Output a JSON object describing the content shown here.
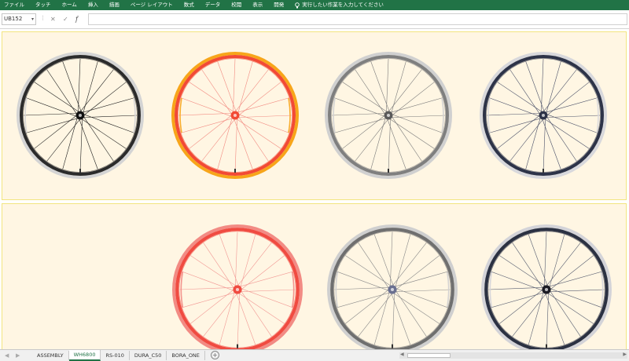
{
  "ribbon": {
    "menu": [
      "ファイル",
      "タッチ",
      "ホーム",
      "挿入",
      "描画",
      "ページ レイアウト",
      "数式",
      "データ",
      "校閲",
      "表示",
      "開発"
    ],
    "tell_me": "実行したい作業を入力してください"
  },
  "formula_bar": {
    "name_box": "UB152",
    "formula": ""
  },
  "sheet": {
    "wheels_row1": [
      {
        "rim": "#2b2b2b",
        "accent": "#d4d4d4",
        "hub": "#111111",
        "spoke": "#1e1e1e"
      },
      {
        "rim": "#f24a35",
        "accent": "#f7a51a",
        "hub": "#f24a35",
        "spoke": "#f28a80"
      },
      {
        "rim": "#7f7f7f",
        "accent": "#d0d0d0",
        "hub": "#5a5a5a",
        "spoke": "#7a7a7a"
      },
      {
        "rim": "#2d3348",
        "accent": "#d8d8dc",
        "hub": "#2d3348",
        "spoke": "#4a5068"
      }
    ],
    "wheels_row2": [
      {
        "rim": "#f04b41",
        "accent": "#f28b84",
        "hub": "#f04b41",
        "spoke": "#f29a95"
      },
      {
        "rim": "#6f6f6f",
        "accent": "#cfcfcf",
        "hub": "#6a7090",
        "spoke": "#8a8a8a"
      },
      {
        "rim": "#2b3142",
        "accent": "#d3d3d8",
        "hub": "#1c1c24",
        "spoke": "#5a6072"
      }
    ]
  },
  "tabs": {
    "items": [
      "ASSEMBLY",
      "WH6800",
      "RS-010",
      "DURA_C50",
      "BORA_ONE"
    ],
    "active": "WH6800"
  }
}
